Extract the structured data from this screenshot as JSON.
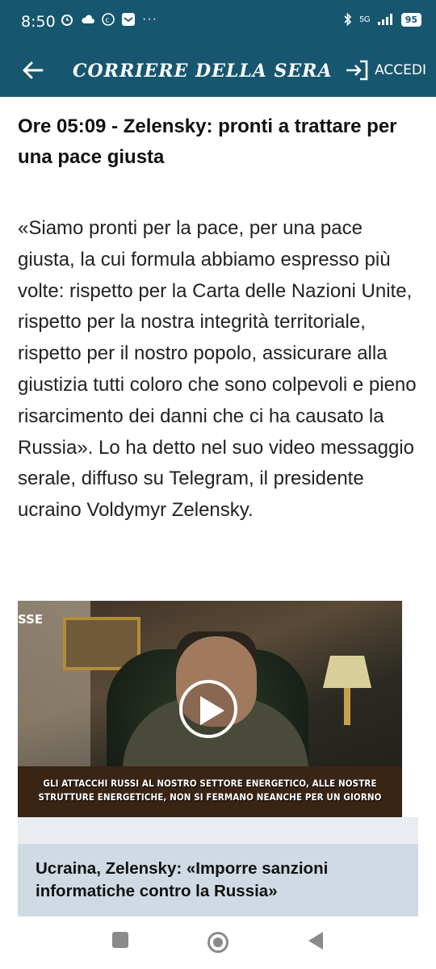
{
  "status_bar": {
    "time": "8:50",
    "network": "5G",
    "battery": "95"
  },
  "header": {
    "logo": "CORRIERE DELLA SERA",
    "login_label": "ACCEDI"
  },
  "article": {
    "title": "Ore 05:09 - Zelensky: pronti a trattare per una pace giusta",
    "body": "«Siamo pronti per la pace, per una pace giusta, la cui formula abbiamo espresso più volte: rispetto per la Carta delle Nazioni Unite, rispetto per la nostra integrità territoriale, rispetto per il nostro popolo, assicurare alla giustizia tutti coloro che sono colpevoli e pieno risarcimento dei danni che ci ha causato la Russia». Lo ha detto nel suo video messaggio serale, diffuso su Telegram, il presidente ucraino Voldymyr Zelensky."
  },
  "video": {
    "channel_tag": "SSE",
    "caption": "GLI ATTACCHI RUSSI AL NOSTRO SETTORE ENERGETICO, ALLE NOSTRE STRUTTURE ENERGETICHE, NON SI FERMANO NEANCHE PER UN GIORNO"
  },
  "related": {
    "title": "Ucraina, Zelensky: «Imporre sanzioni informatiche contro la Russia»"
  },
  "colors": {
    "header_bg": "#17566f",
    "related_bg": "#cfdae5"
  }
}
